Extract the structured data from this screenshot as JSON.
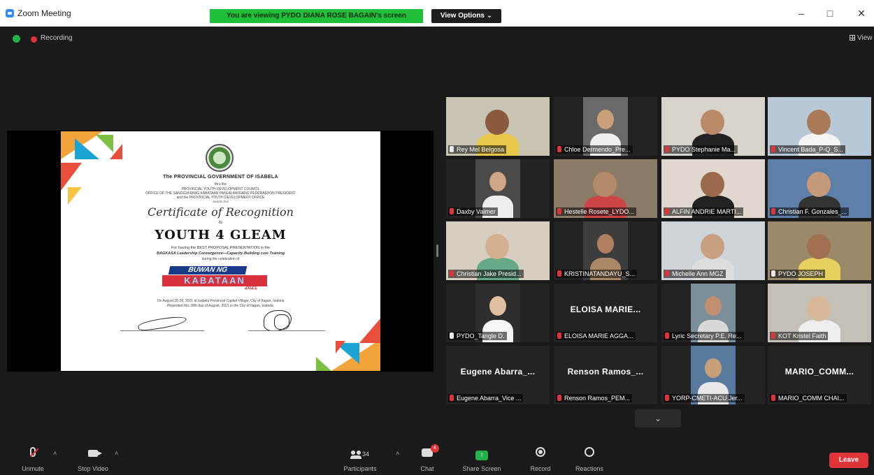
{
  "window": {
    "title": "Zoom Meeting",
    "share_banner": "You are viewing PYDO DIANA ROSE BAGAIN's screen",
    "view_options": "View Options ⌄",
    "minimize": "–",
    "maximize": "□",
    "close": "✕"
  },
  "status": {
    "recording_label": "Recording",
    "view_label": "View"
  },
  "certificate": {
    "org": "The PROVINCIAL GOVERNMENT OF ISABELA",
    "thru": "thru the",
    "line2": "PROVINCIAL YOUTH DEVELOPMENT COUNCIL",
    "line3": "OFFICE OF THE SANGGUNIANG KABATAAN PANLALAWIGANG PEDERASYON PRESIDENT",
    "line4": "and the PROVINCIAL YOUTH DEVELOPMENT OFFICE",
    "line4b": "awards this",
    "heading": "Certificate of Recognition",
    "to": "to",
    "recipient": "YOUTH 4 GLEAM",
    "reason": "For having the BEST PROPOSAL PRESENTATION in the",
    "event": "BAGKASA Leadership Convergence—Capacity-Building cum Training",
    "during": "during the celebration of",
    "buwan_top": "BUWAN NG",
    "buwan_mid": "KABATAAN",
    "buwan_year": "2021",
    "held": "On August 26-28, 2021 at Isabela Provincial Capitol Village, City of Ilagan, Isabela",
    "presented": "Presented this 28th day of August, 2021 in the City of Ilagan, Isabela."
  },
  "gallery": [
    {
      "label": "Rey Mel Belgosa",
      "muted": false,
      "big_name": "",
      "active": true
    },
    {
      "label": "Chloe Dermendo_Pre...",
      "muted": true,
      "big_name": "",
      "active": false
    },
    {
      "label": "PYDO Stephanie Ma...",
      "muted": true,
      "big_name": "",
      "active": false
    },
    {
      "label": "Vincent Bada_P-Q_S...",
      "muted": true,
      "big_name": "",
      "active": false
    },
    {
      "label": "Daxby Vaimer",
      "muted": true,
      "big_name": "",
      "active": false
    },
    {
      "label": "Hestelle Rosete_LYDO...",
      "muted": true,
      "big_name": "",
      "active": false
    },
    {
      "label": "ALFIN ANDRIE MARTI...",
      "muted": true,
      "big_name": "",
      "active": false
    },
    {
      "label": "Christian F. Gonzales_...",
      "muted": true,
      "big_name": "",
      "active": false
    },
    {
      "label": "Christian Jake Presid...",
      "muted": true,
      "big_name": "",
      "active": false
    },
    {
      "label": "KRISTINATANDAYU_S...",
      "muted": true,
      "big_name": "",
      "active": false
    },
    {
      "label": "Michelle Ann MGZ",
      "muted": true,
      "big_name": "",
      "active": false
    },
    {
      "label": "PYDO JOSEPH",
      "muted": false,
      "big_name": "",
      "active": false
    },
    {
      "label": "PYDO_Tangle D.",
      "muted": false,
      "big_name": "",
      "active": false
    },
    {
      "label": "ELOISA MARIE AGGA...",
      "muted": true,
      "big_name": "ELOISA MARIE...",
      "active": false
    },
    {
      "label": "Lyric Secretary P.E. Re...",
      "muted": true,
      "big_name": "",
      "active": false
    },
    {
      "label": "KOT Kristel Faith",
      "muted": true,
      "big_name": "",
      "active": false
    },
    {
      "label": "Eugene Abarra_Vice ...",
      "muted": true,
      "big_name": "Eugene Abarra_...",
      "active": false
    },
    {
      "label": "Renson Ramos_PEM...",
      "muted": true,
      "big_name": "Renson Ramos_...",
      "active": false
    },
    {
      "label": "YORP-CMETI-ACU Jer...",
      "muted": true,
      "big_name": "",
      "active": false
    },
    {
      "label": "MARIO_COMM CHAI...",
      "muted": true,
      "big_name": "MARIO_COMM...",
      "active": false
    }
  ],
  "gallery_scroll": "⌄",
  "toolbar": {
    "unmute": "Unmute",
    "stop_video": "Stop Video",
    "participants": "Participants",
    "participant_count": "34",
    "chat": "Chat",
    "chat_badge": "4",
    "share_screen": "Share Screen",
    "record": "Record",
    "reactions": "Reactions",
    "leave": "Leave",
    "caret": "˄"
  },
  "colors": {
    "share_banner": "#1fbf3a",
    "leave": "#e0343b",
    "active_speaker": "#b9e04a",
    "zoom_blue": "#2d8cff"
  }
}
